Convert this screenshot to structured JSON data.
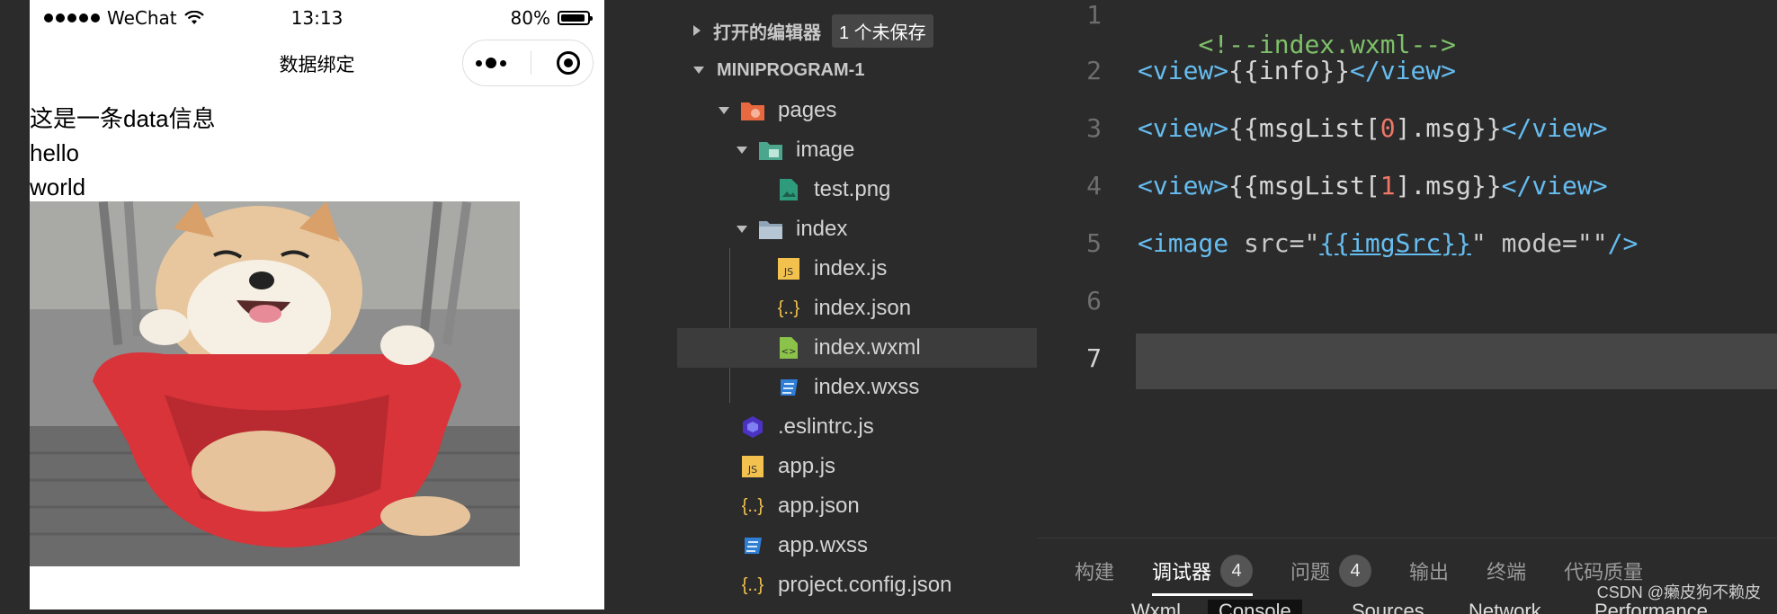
{
  "simulator": {
    "status": {
      "carrier": "WeChat",
      "time": "13:13",
      "battery": "80%",
      "battery_level": 0.8
    },
    "nav_title": "数据绑定",
    "content": {
      "info": "这是一条data信息",
      "msg0": "hello",
      "msg1": "world"
    }
  },
  "explorer": {
    "open_editors_label": "打开的编辑器",
    "unsaved_label": "1 个未保存",
    "project_label": "MINIPROGRAM-1",
    "items": [
      {
        "label": "pages",
        "icon": "folder-pages-icon"
      },
      {
        "label": "image",
        "icon": "folder-image-icon"
      },
      {
        "label": "test.png",
        "icon": "image-file-icon"
      },
      {
        "label": "index",
        "icon": "folder-icon"
      },
      {
        "label": "index.js",
        "icon": "js-file-icon"
      },
      {
        "label": "index.json",
        "icon": "json-file-icon"
      },
      {
        "label": "index.wxml",
        "icon": "wxml-file-icon",
        "selected": true
      },
      {
        "label": "index.wxss",
        "icon": "css-file-icon"
      },
      {
        "label": ".eslintrc.js",
        "icon": "eslint-file-icon"
      },
      {
        "label": "app.js",
        "icon": "js-file-icon"
      },
      {
        "label": "app.json",
        "icon": "json-file-icon"
      },
      {
        "label": "app.wxss",
        "icon": "css-file-icon"
      },
      {
        "label": "project.config.json",
        "icon": "json-file-icon"
      }
    ]
  },
  "editor": {
    "line_numbers": [
      "1",
      "2",
      "3",
      "4",
      "5",
      "6",
      "7"
    ],
    "current_line": "7",
    "lines": {
      "l1": "<!--index.wxml-->",
      "l2_open": "<view>",
      "l2_expr": "{{info}}",
      "l2_close": "</view>",
      "l3_open": "<view>",
      "l3_a": "{{msgList[",
      "l3_n": "0",
      "l3_b": "].msg}}",
      "l3_close": "</view>",
      "l4_open": "<view>",
      "l4_a": "{{msgList[",
      "l4_n": "1",
      "l4_b": "].msg}}",
      "l4_close": "</view>",
      "l5_open": "<image",
      "l5_attr": " src=\"",
      "l5_expr": "{{imgSrc}}",
      "l5_rest": "\" mode=\"\"",
      "l5_close": "/>"
    }
  },
  "panel": {
    "tabs": [
      {
        "label": "构建"
      },
      {
        "label": "调试器",
        "badge": "4",
        "active": true
      },
      {
        "label": "问题",
        "badge": "4"
      },
      {
        "label": "输出"
      },
      {
        "label": "终端"
      },
      {
        "label": "代码质量"
      }
    ],
    "subtabs": [
      "Wxml",
      "Console",
      "Sources",
      "Network",
      "Performance"
    ],
    "watermark": "CSDN @癞皮狗不赖皮"
  },
  "colors": {
    "accent": "#66bdf0",
    "comment": "#7ec16a",
    "number": "#f07668",
    "background": "#2b2b2b"
  }
}
